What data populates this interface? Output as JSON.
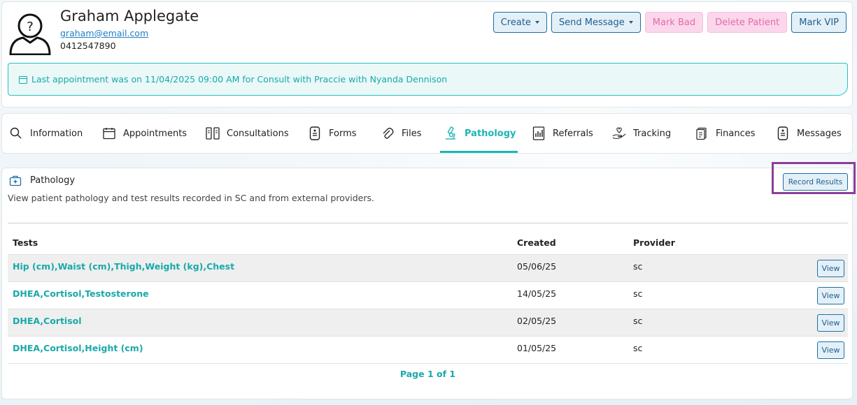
{
  "patient": {
    "name": "Graham Applegate",
    "email": "graham@email.com",
    "phone": "0412547890"
  },
  "actions": {
    "create": "Create",
    "send_message": "Send Message",
    "mark_bad": "Mark Bad",
    "delete_patient": "Delete Patient",
    "mark_vip": "Mark VIP"
  },
  "appointment_banner": "Last appointment was on 11/04/2025 09:00 AM for Consult with Praccie with Nyanda Dennison",
  "tabs": [
    {
      "label": "Information",
      "icon": "search-icon"
    },
    {
      "label": "Appointments",
      "icon": "calendar-icon"
    },
    {
      "label": "Consultations",
      "icon": "consultation-icon"
    },
    {
      "label": "Forms",
      "icon": "form-icon"
    },
    {
      "label": "Files",
      "icon": "paperclip-icon"
    },
    {
      "label": "Pathology",
      "icon": "microscope-icon",
      "active": true
    },
    {
      "label": "Referrals",
      "icon": "referral-icon"
    },
    {
      "label": "Tracking",
      "icon": "heart-hand-icon"
    },
    {
      "label": "Finances",
      "icon": "finance-icon"
    },
    {
      "label": "Messages",
      "icon": "message-icon"
    }
  ],
  "pathology": {
    "title": "Pathology",
    "description": "View patient pathology and test results recorded in SC and from external providers.",
    "record_results": "Record Results",
    "columns": {
      "tests": "Tests",
      "created": "Created",
      "provider": "Provider"
    },
    "rows": [
      {
        "tests": "Hip (cm),Waist (cm),Thigh,Weight (kg),Chest",
        "created": "05/06/25",
        "provider": "sc",
        "action": "View"
      },
      {
        "tests": "DHEA,Cortisol,Testosterone",
        "created": "14/05/25",
        "provider": "sc",
        "action": "View"
      },
      {
        "tests": "DHEA,Cortisol",
        "created": "02/05/25",
        "provider": "sc",
        "action": "View"
      },
      {
        "tests": "DHEA,Cortisol,Height (cm)",
        "created": "01/05/25",
        "provider": "sc",
        "action": "View"
      }
    ],
    "pager": "Page 1 of 1"
  },
  "colors": {
    "accent": "#1eb5b5",
    "button_blue": "#1f6fa5",
    "danger_pink": "#e46aa9",
    "highlight": "#8a3f98"
  }
}
